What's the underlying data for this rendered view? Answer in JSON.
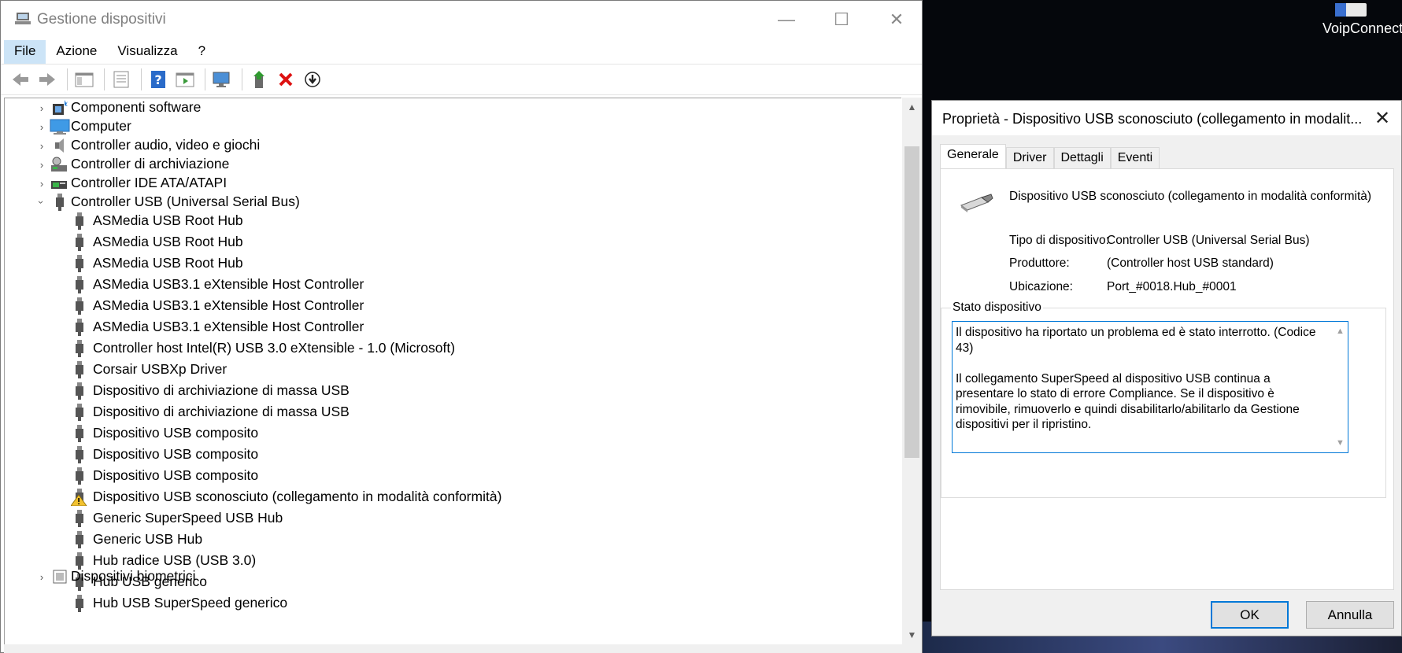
{
  "desktop": {
    "shortcut_label": "VoipConnect"
  },
  "window": {
    "title": "Gestione dispositivi",
    "minimize_glyph": "—",
    "maximize_glyph": "☐",
    "close_glyph": "✕"
  },
  "menu": [
    "File",
    "Azione",
    "Visualizza",
    "?"
  ],
  "tree": {
    "categories": [
      {
        "label": "Componenti software",
        "icon": "software-components-icon"
      },
      {
        "label": "Computer",
        "icon": "computer-icon"
      },
      {
        "label": "Controller audio, video e giochi",
        "icon": "speaker-icon"
      },
      {
        "label": "Controller di archiviazione",
        "icon": "storage-controller-icon"
      },
      {
        "label": "Controller IDE ATA/ATAPI",
        "icon": "ide-controller-icon"
      },
      {
        "label": "Controller USB (Universal Serial Bus)",
        "icon": "usb-icon"
      }
    ],
    "usb_children": [
      "ASMedia USB Root Hub",
      "ASMedia USB Root Hub",
      "ASMedia USB Root Hub",
      "ASMedia USB3.1 eXtensible Host Controller",
      "ASMedia USB3.1 eXtensible Host Controller",
      "ASMedia USB3.1 eXtensible Host Controller",
      "Controller host Intel(R) USB 3.0 eXtensible - 1.0 (Microsoft)",
      "Corsair USBXp Driver",
      "Dispositivo di archiviazione di massa USB",
      "Dispositivo di archiviazione di massa USB",
      "Dispositivo USB composito",
      "Dispositivo USB composito",
      "Dispositivo USB composito",
      "Dispositivo USB sconosciuto (collegamento in modalità conformità)",
      "Generic SuperSpeed USB Hub",
      "Generic USB Hub",
      "Hub radice USB (USB 3.0)",
      "Hub USB generico",
      "Hub USB SuperSpeed generico"
    ],
    "warning_index": 13,
    "next_category": "Dispositivi biometrici"
  },
  "dialog": {
    "title": "Proprietà - Dispositivo USB sconosciuto (collegamento in modalit...",
    "close_glyph": "✕",
    "tabs": [
      "Generale",
      "Driver",
      "Dettagli",
      "Eventi"
    ],
    "device_name": "Dispositivo USB sconosciuto (collegamento in modalità conformità)",
    "properties": {
      "type_label": "Tipo di dispositivo:",
      "type_value": "Controller USB (Universal Serial Bus)",
      "manufacturer_label": "Produttore:",
      "manufacturer_value": "(Controller host USB standard)",
      "location_label": "Ubicazione:",
      "location_value": "Port_#0018.Hub_#0001"
    },
    "status_group_label": "Stato dispositivo",
    "status_text": "Il dispositivo ha riportato un problema ed è stato interrotto. (Codice 43)\n\nIl collegamento SuperSpeed al dispositivo USB continua a presentare lo stato di errore Compliance. Se il dispositivo è rimovibile, rimuoverlo e quindi disabilitarlo/abilitarlo da Gestione dispositivi per il ripristino.",
    "ok_label": "OK",
    "cancel_label": "Annulla"
  }
}
